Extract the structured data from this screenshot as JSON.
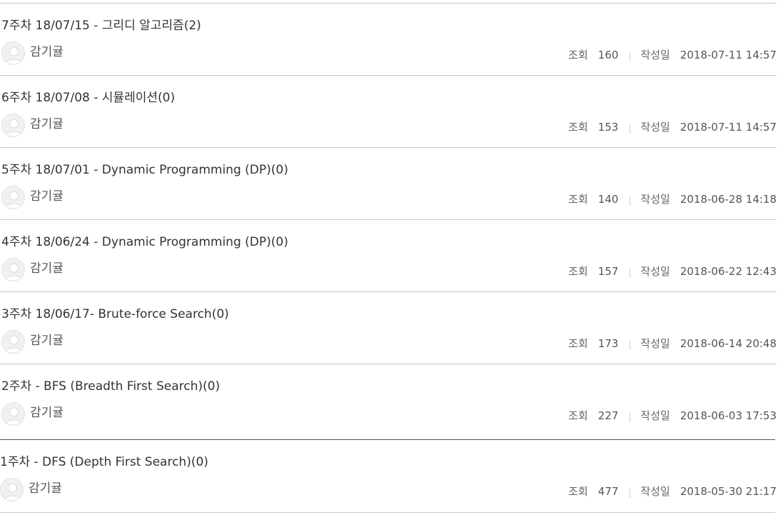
{
  "labels": {
    "views": "조회",
    "date": "작성일"
  },
  "posts": [
    {
      "title": "7주차 18/07/15 - 그리디 알고리즘",
      "comments": "(2)",
      "author": "감기귤",
      "views": "160",
      "date": "2018-07-11 14:57"
    },
    {
      "title": "6주차 18/07/08 - 시뮬레이션",
      "comments": "(0)",
      "author": "감기귤",
      "views": "153",
      "date": "2018-07-11 14:57"
    },
    {
      "title": "5주차 18/07/01 - Dynamic Programming (DP)",
      "comments": "(0)",
      "author": "감기귤",
      "views": "140",
      "date": "2018-06-28 14:18"
    },
    {
      "title": "4주차 18/06/24 - Dynamic Programming (DP)",
      "comments": "(0)",
      "author": "감기귤",
      "views": "157",
      "date": "2018-06-22 12:43"
    },
    {
      "title": "3주차 18/06/17- Brute-force Search",
      "comments": "(0)",
      "author": "감기귤",
      "views": "173",
      "date": "2018-06-14 20:48"
    },
    {
      "title": "2주차 - BFS (Breadth First Search)",
      "comments": "(0)",
      "author": "감기귤",
      "views": "227",
      "date": "2018-06-03 17:53"
    },
    {
      "title": "1주차 - DFS (Depth First Search)",
      "comments": "(0)",
      "author": "감기귤",
      "views": "477",
      "date": "2018-05-30 21:17"
    }
  ]
}
